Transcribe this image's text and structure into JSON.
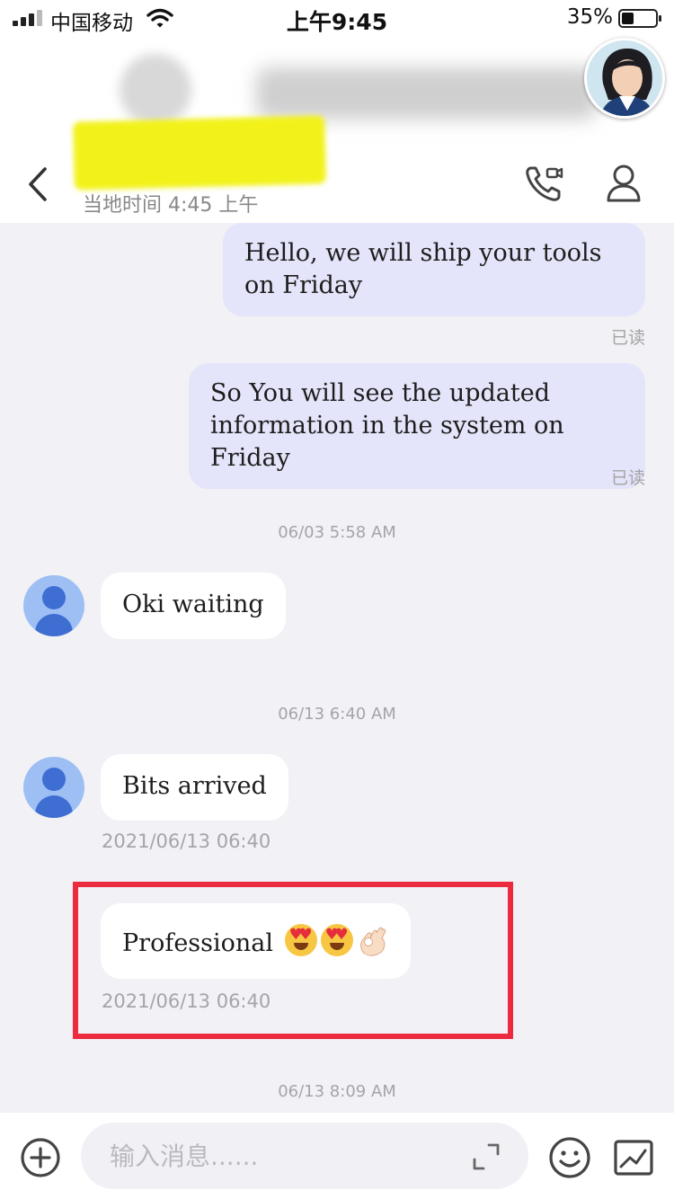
{
  "status_bar": {
    "carrier": "中国移动",
    "time": "上午9:45",
    "battery_percent": "35%",
    "battery_level": 0.35
  },
  "header": {
    "local_time": "当地时间 4:45 上午",
    "icons": [
      "back-icon",
      "video-call-icon",
      "profile-icon"
    ]
  },
  "messages": [
    {
      "direction": "outgoing",
      "text": "Hello, we will ship your tools on Friday",
      "status": "已读"
    },
    {
      "direction": "outgoing",
      "text": "So You will see the updated information in the system on Friday",
      "status": "已读"
    },
    {
      "timestamp": "06/03 5:58 AM"
    },
    {
      "direction": "incoming",
      "text": "Oki waiting"
    },
    {
      "timestamp": "06/13 6:40 AM"
    },
    {
      "direction": "incoming",
      "text": "Bits arrived",
      "sub_time": "2021/06/13 06:40"
    },
    {
      "direction": "incoming",
      "text": "Professional",
      "emojis": [
        "heart-eyes-emoji",
        "heart-eyes-emoji",
        "ok-hand-emoji"
      ],
      "sub_time": "2021/06/13 06:40",
      "highlighted": true
    },
    {
      "timestamp": "06/13 8:09 AM"
    }
  ],
  "input_bar": {
    "placeholder": "输入消息......",
    "icons": [
      "plus-icon",
      "expand-icon",
      "emoji-icon",
      "image-icon"
    ]
  },
  "colors": {
    "outgoing_bubble": "#e4e4fa",
    "incoming_bubble": "#ffffff",
    "background": "#f1f1f6",
    "highlight_box": "#ec2b3e",
    "avatar_blue": "#3e6ed2"
  }
}
